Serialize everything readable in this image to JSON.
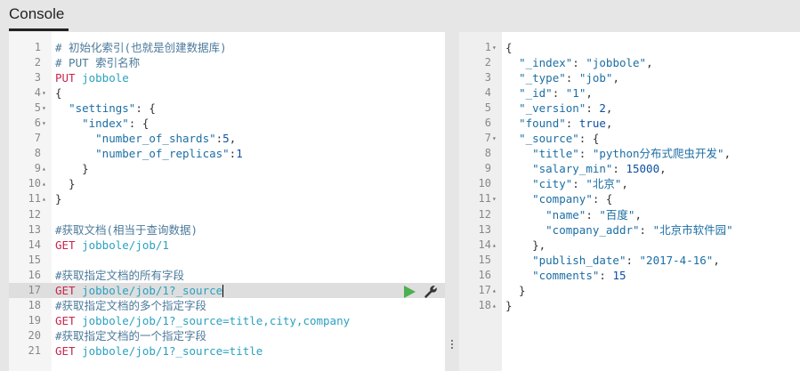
{
  "tab": {
    "label": "Console"
  },
  "editor": {
    "lines": [
      {
        "n": "1",
        "fold": "",
        "segments": [
          {
            "t": "# 初始化索引(也就是创建数据库)",
            "c": "c-comment"
          }
        ]
      },
      {
        "n": "2",
        "fold": "",
        "segments": [
          {
            "t": "# PUT 索引名称",
            "c": "c-comment"
          }
        ]
      },
      {
        "n": "3",
        "fold": "",
        "segments": [
          {
            "t": "PUT ",
            "c": "c-method"
          },
          {
            "t": "jobbole",
            "c": "c-url"
          }
        ]
      },
      {
        "n": "4",
        "fold": "▾",
        "segments": [
          {
            "t": "{",
            "c": "c-punc"
          }
        ]
      },
      {
        "n": "5",
        "fold": "▾",
        "segments": [
          {
            "t": "  ",
            "c": "c-punc"
          },
          {
            "t": "\"settings\"",
            "c": "c-key"
          },
          {
            "t": ": {",
            "c": "c-punc"
          }
        ]
      },
      {
        "n": "6",
        "fold": "▾",
        "segments": [
          {
            "t": "    ",
            "c": "c-punc"
          },
          {
            "t": "\"index\"",
            "c": "c-key"
          },
          {
            "t": ": {",
            "c": "c-punc"
          }
        ]
      },
      {
        "n": "7",
        "fold": "",
        "segments": [
          {
            "t": "      ",
            "c": "c-punc"
          },
          {
            "t": "\"number_of_shards\"",
            "c": "c-key"
          },
          {
            "t": ":",
            "c": "c-punc"
          },
          {
            "t": "5",
            "c": "c-num"
          },
          {
            "t": ",",
            "c": "c-punc"
          }
        ]
      },
      {
        "n": "8",
        "fold": "",
        "segments": [
          {
            "t": "      ",
            "c": "c-punc"
          },
          {
            "t": "\"number_of_replicas\"",
            "c": "c-key"
          },
          {
            "t": ":",
            "c": "c-punc"
          },
          {
            "t": "1",
            "c": "c-num"
          }
        ]
      },
      {
        "n": "9",
        "fold": "▴",
        "segments": [
          {
            "t": "    }",
            "c": "c-punc"
          }
        ]
      },
      {
        "n": "10",
        "fold": "▴",
        "segments": [
          {
            "t": "  }",
            "c": "c-punc"
          }
        ]
      },
      {
        "n": "11",
        "fold": "▴",
        "segments": [
          {
            "t": "}",
            "c": "c-punc"
          }
        ]
      },
      {
        "n": "12",
        "fold": "",
        "segments": []
      },
      {
        "n": "13",
        "fold": "",
        "segments": [
          {
            "t": "#获取文档(相当于查询数据)",
            "c": "c-comment"
          }
        ]
      },
      {
        "n": "14",
        "fold": "",
        "segments": [
          {
            "t": "GET ",
            "c": "c-method"
          },
          {
            "t": "jobbole/job/1",
            "c": "c-url"
          }
        ]
      },
      {
        "n": "15",
        "fold": "",
        "segments": []
      },
      {
        "n": "16",
        "fold": "",
        "segments": [
          {
            "t": "#获取指定文档的所有字段",
            "c": "c-comment"
          }
        ]
      },
      {
        "n": "17",
        "fold": "",
        "active": true,
        "segments": [
          {
            "t": "GET ",
            "c": "c-method"
          },
          {
            "t": "jobbole/job/1?_source",
            "c": "c-url"
          }
        ]
      },
      {
        "n": "18",
        "fold": "",
        "segments": [
          {
            "t": "#获取指定文档的多个指定字段",
            "c": "c-comment"
          }
        ]
      },
      {
        "n": "19",
        "fold": "",
        "segments": [
          {
            "t": "GET ",
            "c": "c-method"
          },
          {
            "t": "jobbole/job/1?_source=title,city,company",
            "c": "c-url"
          }
        ]
      },
      {
        "n": "20",
        "fold": "",
        "segments": [
          {
            "t": "#获取指定文档的一个指定字段",
            "c": "c-comment"
          }
        ]
      },
      {
        "n": "21",
        "fold": "",
        "segments": [
          {
            "t": "GET ",
            "c": "c-method"
          },
          {
            "t": "jobbole/job/1?_source=title",
            "c": "c-url"
          }
        ]
      }
    ]
  },
  "output": {
    "lines": [
      {
        "n": "1",
        "fold": "▾",
        "segments": [
          {
            "t": "{",
            "c": "c-punc"
          }
        ]
      },
      {
        "n": "2",
        "fold": "",
        "segments": [
          {
            "t": "  ",
            "c": "c-punc"
          },
          {
            "t": "\"_index\"",
            "c": "c-key"
          },
          {
            "t": ": ",
            "c": "c-punc"
          },
          {
            "t": "\"jobbole\"",
            "c": "c-str"
          },
          {
            "t": ",",
            "c": "c-punc"
          }
        ]
      },
      {
        "n": "3",
        "fold": "",
        "segments": [
          {
            "t": "  ",
            "c": "c-punc"
          },
          {
            "t": "\"_type\"",
            "c": "c-key"
          },
          {
            "t": ": ",
            "c": "c-punc"
          },
          {
            "t": "\"job\"",
            "c": "c-str"
          },
          {
            "t": ",",
            "c": "c-punc"
          }
        ]
      },
      {
        "n": "4",
        "fold": "",
        "segments": [
          {
            "t": "  ",
            "c": "c-punc"
          },
          {
            "t": "\"_id\"",
            "c": "c-key"
          },
          {
            "t": ": ",
            "c": "c-punc"
          },
          {
            "t": "\"1\"",
            "c": "c-str"
          },
          {
            "t": ",",
            "c": "c-punc"
          }
        ]
      },
      {
        "n": "5",
        "fold": "",
        "segments": [
          {
            "t": "  ",
            "c": "c-punc"
          },
          {
            "t": "\"_version\"",
            "c": "c-key"
          },
          {
            "t": ": ",
            "c": "c-punc"
          },
          {
            "t": "2",
            "c": "c-num"
          },
          {
            "t": ",",
            "c": "c-punc"
          }
        ]
      },
      {
        "n": "6",
        "fold": "",
        "segments": [
          {
            "t": "  ",
            "c": "c-punc"
          },
          {
            "t": "\"found\"",
            "c": "c-key"
          },
          {
            "t": ": ",
            "c": "c-punc"
          },
          {
            "t": "true",
            "c": "c-bool"
          },
          {
            "t": ",",
            "c": "c-punc"
          }
        ]
      },
      {
        "n": "7",
        "fold": "▾",
        "segments": [
          {
            "t": "  ",
            "c": "c-punc"
          },
          {
            "t": "\"_source\"",
            "c": "c-key"
          },
          {
            "t": ": {",
            "c": "c-punc"
          }
        ]
      },
      {
        "n": "8",
        "fold": "",
        "segments": [
          {
            "t": "    ",
            "c": "c-punc"
          },
          {
            "t": "\"title\"",
            "c": "c-key"
          },
          {
            "t": ": ",
            "c": "c-punc"
          },
          {
            "t": "\"python分布式爬虫开发\"",
            "c": "c-str"
          },
          {
            "t": ",",
            "c": "c-punc"
          }
        ]
      },
      {
        "n": "9",
        "fold": "",
        "segments": [
          {
            "t": "    ",
            "c": "c-punc"
          },
          {
            "t": "\"salary_min\"",
            "c": "c-key"
          },
          {
            "t": ": ",
            "c": "c-punc"
          },
          {
            "t": "15000",
            "c": "c-num"
          },
          {
            "t": ",",
            "c": "c-punc"
          }
        ]
      },
      {
        "n": "10",
        "fold": "",
        "segments": [
          {
            "t": "    ",
            "c": "c-punc"
          },
          {
            "t": "\"city\"",
            "c": "c-key"
          },
          {
            "t": ": ",
            "c": "c-punc"
          },
          {
            "t": "\"北京\"",
            "c": "c-str"
          },
          {
            "t": ",",
            "c": "c-punc"
          }
        ]
      },
      {
        "n": "11",
        "fold": "▾",
        "segments": [
          {
            "t": "    ",
            "c": "c-punc"
          },
          {
            "t": "\"company\"",
            "c": "c-key"
          },
          {
            "t": ": {",
            "c": "c-punc"
          }
        ]
      },
      {
        "n": "12",
        "fold": "",
        "segments": [
          {
            "t": "      ",
            "c": "c-punc"
          },
          {
            "t": "\"name\"",
            "c": "c-key"
          },
          {
            "t": ": ",
            "c": "c-punc"
          },
          {
            "t": "\"百度\"",
            "c": "c-str"
          },
          {
            "t": ",",
            "c": "c-punc"
          }
        ]
      },
      {
        "n": "13",
        "fold": "",
        "segments": [
          {
            "t": "      ",
            "c": "c-punc"
          },
          {
            "t": "\"company_addr\"",
            "c": "c-key"
          },
          {
            "t": ": ",
            "c": "c-punc"
          },
          {
            "t": "\"北京市软件园\"",
            "c": "c-str"
          }
        ]
      },
      {
        "n": "14",
        "fold": "▴",
        "segments": [
          {
            "t": "    },",
            "c": "c-punc"
          }
        ]
      },
      {
        "n": "15",
        "fold": "",
        "segments": [
          {
            "t": "    ",
            "c": "c-punc"
          },
          {
            "t": "\"publish_date\"",
            "c": "c-key"
          },
          {
            "t": ": ",
            "c": "c-punc"
          },
          {
            "t": "\"2017-4-16\"",
            "c": "c-str"
          },
          {
            "t": ",",
            "c": "c-punc"
          }
        ]
      },
      {
        "n": "16",
        "fold": "",
        "segments": [
          {
            "t": "    ",
            "c": "c-punc"
          },
          {
            "t": "\"comments\"",
            "c": "c-key"
          },
          {
            "t": ": ",
            "c": "c-punc"
          },
          {
            "t": "15",
            "c": "c-num"
          }
        ]
      },
      {
        "n": "17",
        "fold": "▴",
        "segments": [
          {
            "t": "  }",
            "c": "c-punc"
          }
        ]
      },
      {
        "n": "18",
        "fold": "▴",
        "segments": [
          {
            "t": "}",
            "c": "c-punc"
          }
        ]
      }
    ]
  },
  "icons": {
    "run": "play-icon",
    "settings": "wrench-icon"
  },
  "colors": {
    "method": "#c7254e",
    "url": "#2aa1c0",
    "comment": "#4c7a9b",
    "run": "#4caf50"
  }
}
